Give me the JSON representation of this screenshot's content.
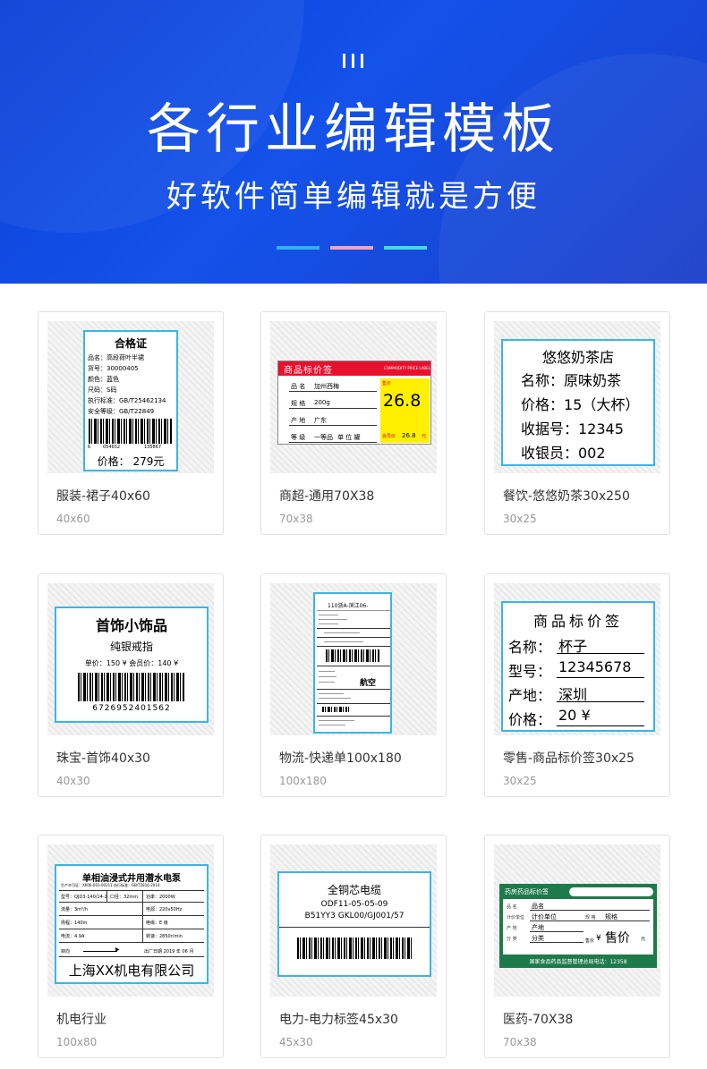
{
  "header": {
    "title": "各行业编辑模板",
    "subtitle": "好软件简单编辑就是方便",
    "accent_colors": [
      "#2fb2f0",
      "#f3a3bf",
      "#43dbe6"
    ]
  },
  "cards": [
    {
      "name": "服装-裙子40x60",
      "size": "40x60",
      "label": {
        "title": "合格证",
        "lines": [
          "品名：高段荷叶半裙",
          "货号：30000405",
          "颜色：蓝色",
          "尺码：S码",
          "执行标准：GB/T25462134",
          "安全等级：GB/T22849"
        ],
        "barcode_digits": [
          "6",
          "054652",
          "135867"
        ],
        "price": "价格： 279元"
      }
    },
    {
      "name": "商超-通用70X38",
      "size": "70x38",
      "label": {
        "title": "商品标价签",
        "title_en": "COMMODITY PRICE LABEL",
        "rows": [
          [
            "品  名",
            "加州西梅"
          ],
          [
            "规  格",
            "200g"
          ],
          [
            "产  地",
            "广东"
          ],
          [
            "等  级",
            "一等品"
          ]
        ],
        "unit": "单 位  罐",
        "price_tag": "售价",
        "price": "26.8",
        "member_label": "会员价",
        "member_price": "26.8",
        "currency": "元"
      }
    },
    {
      "name": "餐饮-悠悠奶茶30x250",
      "size": "30x25",
      "label": {
        "title": "悠悠奶茶店",
        "lines": [
          "名称：原味奶茶",
          "价格：15（大杯）",
          "收据号：12345",
          "收银员：002"
        ]
      }
    },
    {
      "name": "珠宝-首饰40x30",
      "size": "40x30",
      "label": {
        "title": "首饰小饰品",
        "subtitle": "纯银戒指",
        "price_line": "单价：150 ¥    会员价：140 ¥",
        "barcode_text": "6726952401562"
      }
    },
    {
      "name": "物流-快递单100x180",
      "size": "100x180",
      "label": {
        "top": "110浙A-滨江06-",
        "big": "航空"
      }
    },
    {
      "name": "零售-商品标价签30x25",
      "size": "30x25",
      "label": {
        "title": "商品标价签",
        "rows": [
          [
            "名称：",
            "杯子"
          ],
          [
            "型号：",
            "12345678"
          ],
          [
            "产地：",
            "深圳"
          ],
          [
            "价格：",
            "20 ¥"
          ]
        ]
      }
    },
    {
      "name": "机电行业",
      "size": "100x80",
      "label": {
        "title": "单相油浸式井用潜水电泵",
        "line1": "生产许可证：XK06-003-00211     执行标准：GB/T2816-2014",
        "specs": [
          [
            "型号：QJD3-140/14-2",
            "口径：32mm",
            "功率：2000W"
          ],
          [
            "流量：3m³/h",
            "",
            "电源：220v50Hz"
          ],
          [
            "扬程：140m",
            "",
            "绝缘：E 级"
          ],
          [
            "电流：4.9A",
            "",
            "转速：2850r/min"
          ]
        ],
        "direction": "转向",
        "date": "出厂日期 2019 年 06 月",
        "company": "上海XX机电有限公司"
      }
    },
    {
      "name": "电力-电力标签45x30",
      "size": "45x30",
      "label": {
        "title": "全铜芯电缆",
        "line1": "ODF11-05-05-09",
        "line2": "B51YY3 GKL00/GJ001/57"
      }
    },
    {
      "name": "医药-70X38",
      "size": "70x38",
      "label": {
        "title": "药房药品标价签",
        "rows": [
          [
            "品    名",
            "品名"
          ],
          [
            "计价单位",
            "计价单位"
          ],
          [
            "产    地",
            "产地"
          ],
          [
            "分    类",
            "分类"
          ]
        ],
        "spec_label": "规    格",
        "spec_value": "规格",
        "price_label": "售价",
        "currency": "¥",
        "price_text": "售价",
        "yuan": "元",
        "footer": "国家食品药品监督管理总局电话：12358"
      }
    }
  ]
}
